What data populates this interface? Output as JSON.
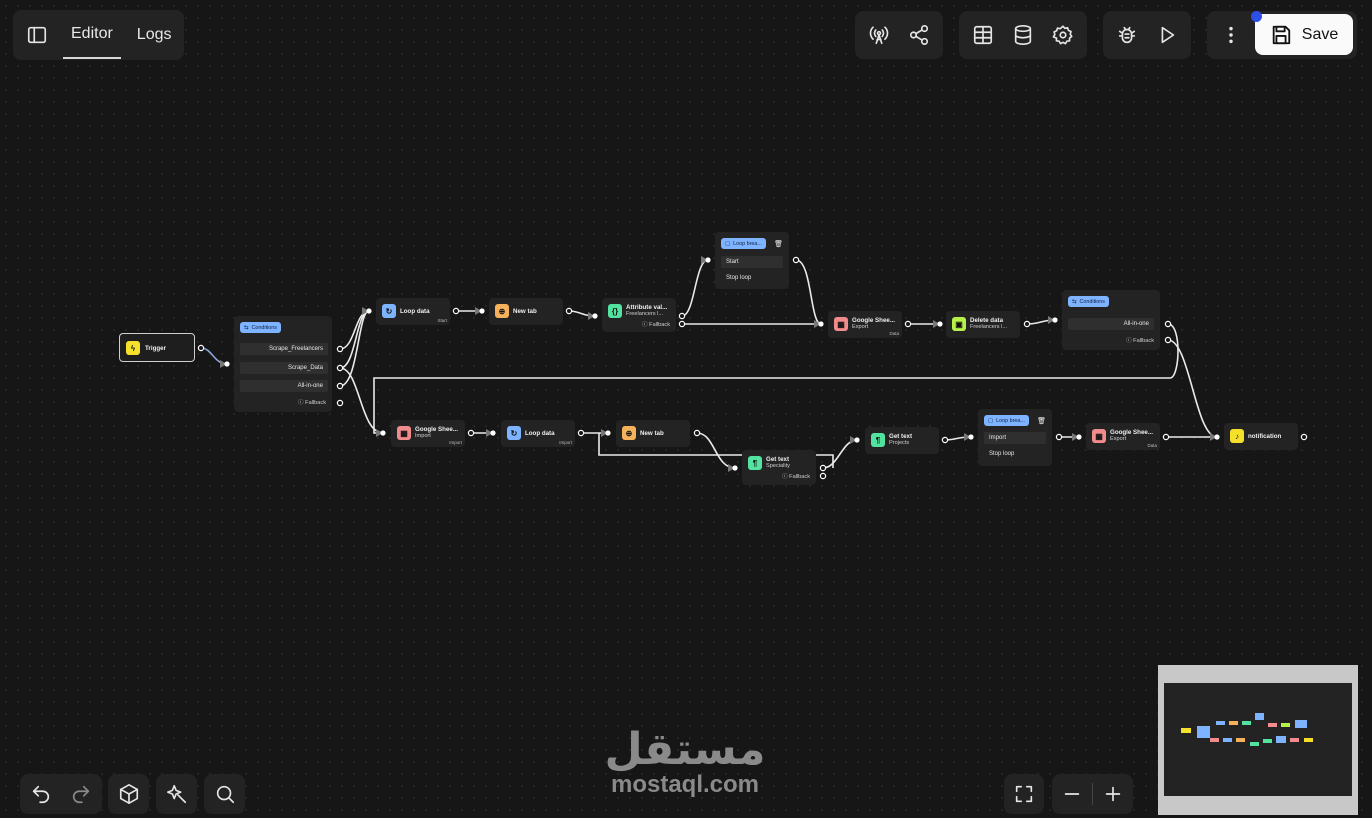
{
  "toolbar": {
    "tabs": [
      {
        "label": "Editor"
      },
      {
        "label": "Logs"
      }
    ],
    "save_label": "Save"
  },
  "nodes": {
    "trigger": {
      "title": "Trigger"
    },
    "conditions1": {
      "chip": "Conditions",
      "rows": [
        "Scrape_Freelancers",
        "Scrape_Data",
        "All-in-one"
      ],
      "fallback": "ⓘ Fallback"
    },
    "loop1": {
      "title": "Loop data",
      "tag": "Start"
    },
    "newtab1": {
      "title": "New tab"
    },
    "attr": {
      "title": "Attribute val...",
      "sub": "Freelancers l...",
      "fallback": "ⓘ Fallback"
    },
    "loopbreak1": {
      "chip": "Loop brea...",
      "rows": [
        "Start",
        "Stop loop"
      ]
    },
    "sheets_export1": {
      "title": "Google Shee...",
      "sub": "Export",
      "tag": "Data"
    },
    "delete": {
      "title": "Delete data",
      "sub": "Freelancers l..."
    },
    "conditions2": {
      "chip": "Conditions",
      "rows": [
        "All-in-one"
      ],
      "fallback": "ⓘ Fallback"
    },
    "sheets_import": {
      "title": "Google Shee...",
      "sub": "Import",
      "tag": "Import"
    },
    "loop2": {
      "title": "Loop data",
      "tag": "Import"
    },
    "newtab2": {
      "title": "New tab"
    },
    "gettext1": {
      "title": "Get text",
      "sub": "Speciality",
      "fallback": "ⓘ Fallback"
    },
    "gettext2": {
      "title": "Get text",
      "sub": "Projects"
    },
    "loopbreak2": {
      "chip": "Loop brea...",
      "rows": [
        "Import",
        "Stop loop"
      ]
    },
    "sheets_export2": {
      "title": "Google Shee...",
      "sub": "Export",
      "tag": "Data"
    },
    "notification": {
      "title": "notification"
    }
  },
  "watermark": {
    "arabic": "مستقل",
    "latin": "mostaql.com"
  },
  "colors": {
    "loop": "#7db3ff",
    "newtab": "#f6b25a",
    "sheets": "#f28b8b",
    "gettext": "#52e3a0",
    "trigger": "#f5e12a",
    "delete": "#b6f24a"
  }
}
